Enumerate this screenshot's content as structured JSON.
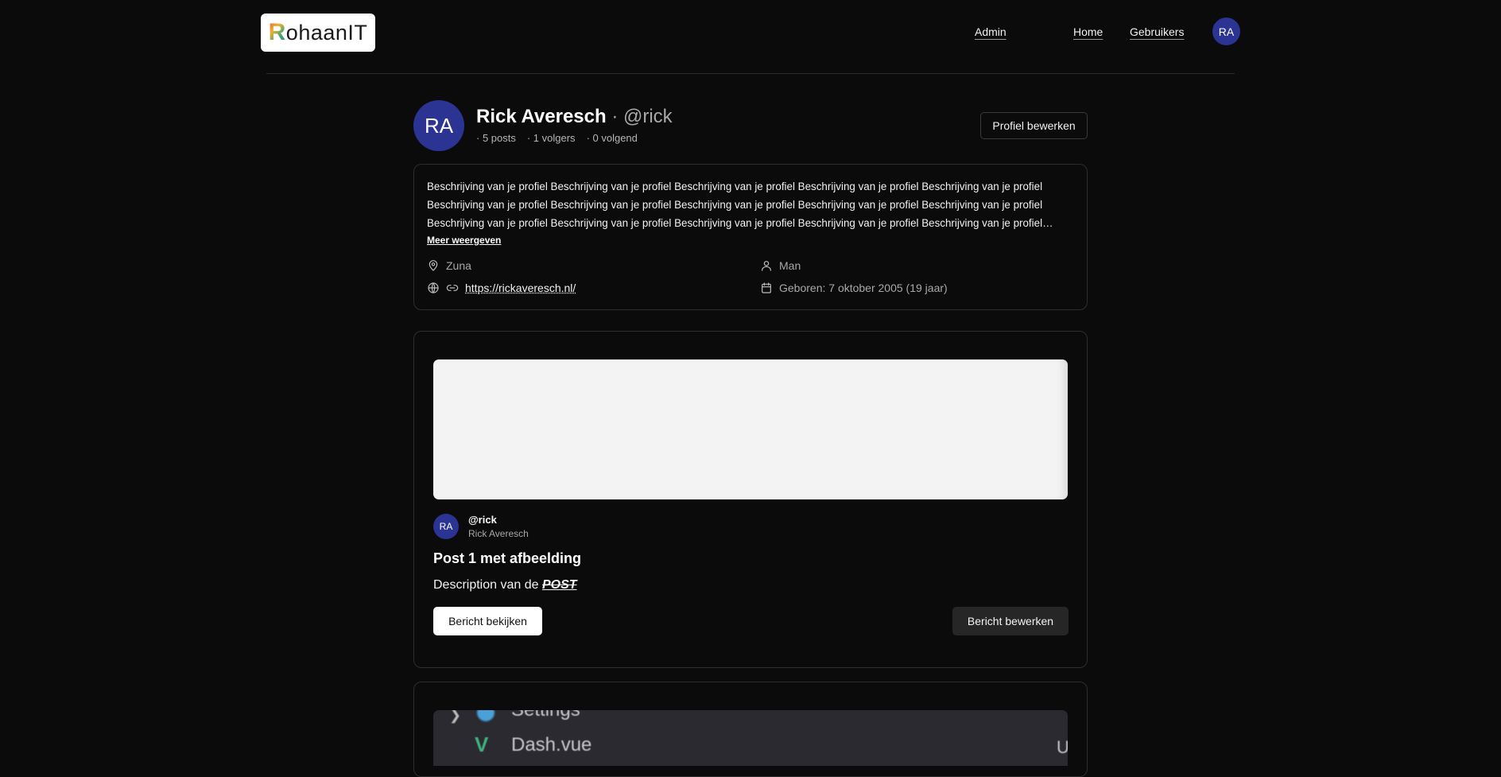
{
  "nav": {
    "logo_letter": "R",
    "logo_rest": "ohaanIT",
    "links": {
      "admin": "Admin",
      "home": "Home",
      "users": "Gebruikers"
    },
    "avatar_initials": "RA"
  },
  "profile": {
    "avatar_initials": "RA",
    "name": "Rick Averesch",
    "separator": " · ",
    "handle": "@rick",
    "stats": {
      "posts": "· 5 posts",
      "followers": "· 1 volgers",
      "following": "· 0 volgend"
    },
    "edit_button": "Profiel bewerken"
  },
  "bio": {
    "text": "Beschrijving van je profiel Beschrijving van je profiel Beschrijving van je profiel Beschrijving van je profiel Beschrijving van je profiel Beschrijving van je profiel Beschrijving van je profiel Beschrijving van je profiel Beschrijving van je profiel Beschrijving van je profiel Beschrijving van je profiel Beschrijving van je profiel Beschrijving van je profiel Beschrijving van je profiel Beschrijving van je profiel Beschrijving...",
    "more_link": "Meer weergeven",
    "location": "Zuna",
    "gender": "Man",
    "website": "https://rickaveresch.nl/",
    "birth": "Geboren: 7 oktober 2005 (19 jaar)"
  },
  "posts": [
    {
      "author_initials": "RA",
      "author_handle": "@rick",
      "author_name": "Rick Averesch",
      "title": "Post 1 met afbeelding",
      "description_prefix": "Description van de ",
      "description_emphasis": "POST",
      "view_button": "Bericht bekijken",
      "edit_button": "Bericht bewerken"
    }
  ],
  "post2_image": {
    "row1": "Settings",
    "row2": "Dash.vue",
    "vue_glyph": "V",
    "badge": "U"
  },
  "colors": {
    "background": "#0b0b0b",
    "avatar": "#2b3393",
    "card_border": "#2e2e2e"
  }
}
